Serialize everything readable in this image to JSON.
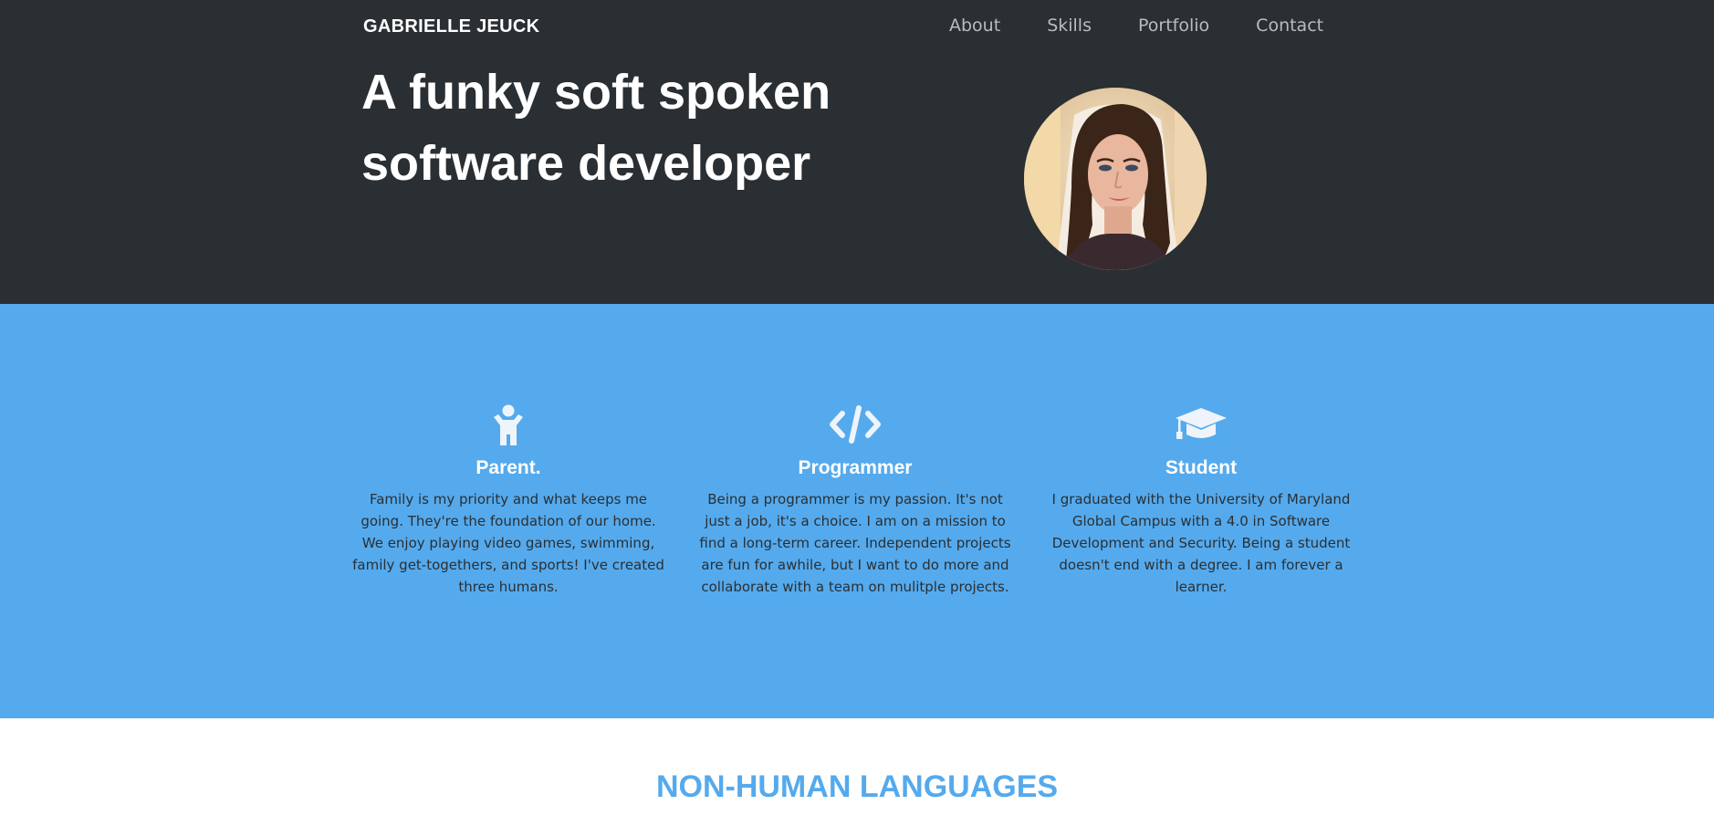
{
  "brand": "GABRIELLE JEUCK",
  "nav": [
    {
      "label": "About"
    },
    {
      "label": "Skills"
    },
    {
      "label": "Portfolio"
    },
    {
      "label": "Contact"
    }
  ],
  "hero": {
    "headline": "A funky soft spoken software developer"
  },
  "about": {
    "columns": [
      {
        "icon": "child-icon",
        "title": "Parent.",
        "text": "Family is my priority and what keeps me going. They're the foundation of our home. We enjoy playing video games, swimming, family get-togethers, and sports! I've created three humans."
      },
      {
        "icon": "code-icon",
        "title": "Programmer",
        "text": "Being a programmer is my passion. It's not just a job, it's a choice. I am on a mission to find a long-term career. Independent projects are fun for awhile, but I want to do more and collaborate with a team on mulitple projects."
      },
      {
        "icon": "graduation-cap-icon",
        "title": "Student",
        "text": "I graduated with the University of Maryland Global Campus with a 4.0 in Software Development and Security. Being a student doesn't end with a degree. I am forever a learner."
      }
    ]
  },
  "skills": {
    "title": "NON-HUMAN LANGUAGES"
  },
  "colors": {
    "hero_bg": "#2a2f33",
    "accent_blue": "#55aaed",
    "text_dark": "#2a2f33",
    "nav_text": "#b8bcbf"
  }
}
